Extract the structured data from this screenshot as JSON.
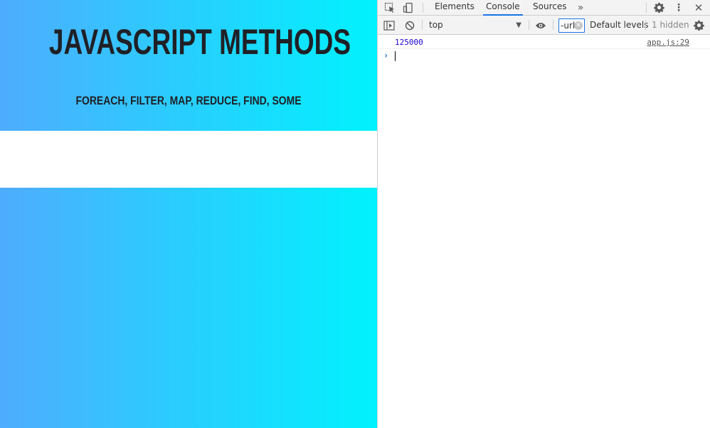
{
  "page": {
    "title": "JavaScript Methods",
    "subtitle": "forEach, filter, map, reduce, find, some",
    "gradient_start": "#4facfe",
    "gradient_end": "#00f2fe",
    "text_color": "#1f2026"
  },
  "devtools": {
    "tabs": [
      {
        "label": "Elements",
        "active": false
      },
      {
        "label": "Console",
        "active": true
      },
      {
        "label": "Sources",
        "active": false
      }
    ],
    "more_tabs_icon": "chevron-double-right-icon",
    "toolbar": {
      "context": "top",
      "filter_value": "-url",
      "levels_label": "Default levels",
      "hidden_label": "1 hidden"
    },
    "console": {
      "log": {
        "value": "125000",
        "source": "app.js:29"
      },
      "prompt_symbol": "›"
    },
    "accent_color": "#1a73e8"
  }
}
